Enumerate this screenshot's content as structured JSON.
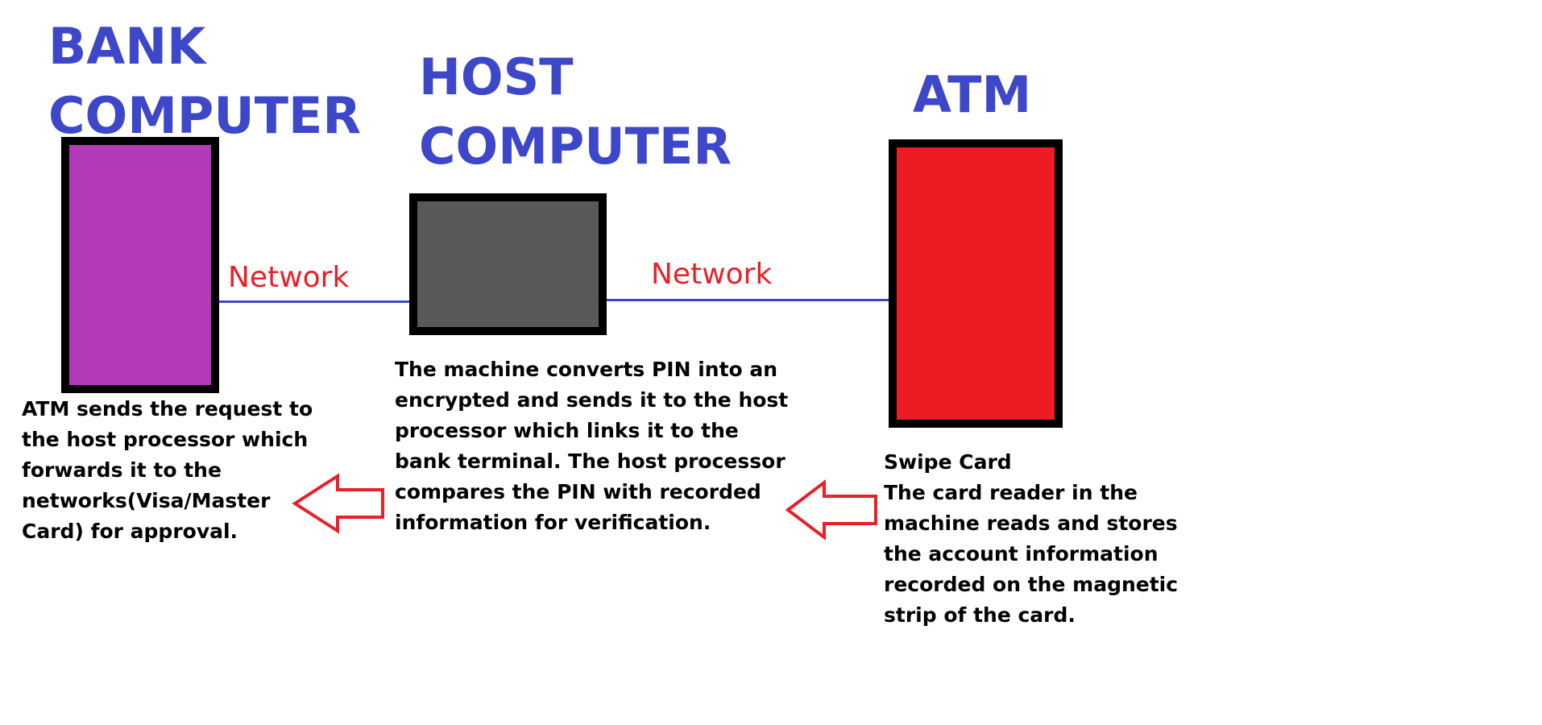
{
  "colors": {
    "title": "#3d47c9",
    "network_label": "#e8202a",
    "network_line": "#3d47c9",
    "arrow": "#e8202a",
    "bank_box": "#b33bba",
    "host_box": "#595959",
    "atm_box": "#ed1c24"
  },
  "nodes": {
    "bank": {
      "title": "BANK\nCOMPUTER",
      "description": "ATM sends the request to\nthe host processor which\nforwards it to the\nnetworks(Visa/Master\nCard) for approval."
    },
    "host": {
      "title": "HOST\nCOMPUTER",
      "description": "The machine converts PIN into an\nencrypted and sends it to the host\nprocessor which links it to the\nbank terminal. The host processor\ncompares the PIN with recorded\ninformation for verification."
    },
    "atm": {
      "title": "ATM",
      "description": "Swipe Card\nThe card reader in the\nmachine reads and stores\nthe account information\nrecorded on the magnetic\nstrip of the card."
    }
  },
  "links": {
    "bank_host": "Network",
    "host_atm": "Network"
  },
  "flow_arrows": [
    {
      "from": "atm",
      "to": "host",
      "direction": "left"
    },
    {
      "from": "host",
      "to": "bank",
      "direction": "left"
    }
  ]
}
